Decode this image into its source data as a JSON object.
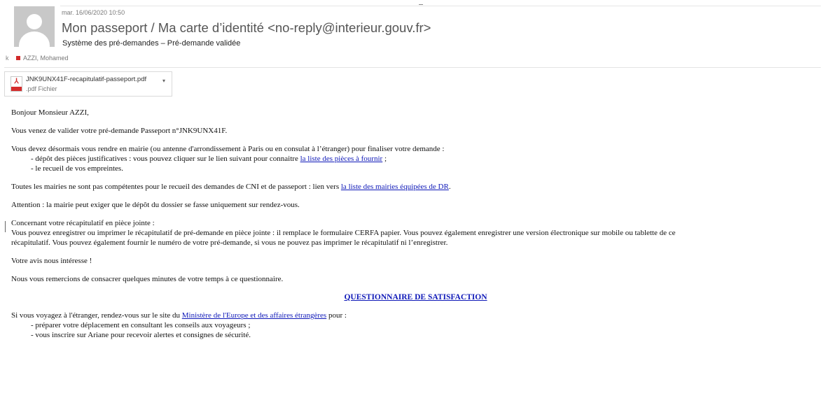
{
  "header": {
    "date": "mar. 16/06/2020 10:50",
    "sender": "Mon passeport / Ma carte d’identité <no-reply@interieur.gouv.fr>",
    "subject": "Système des pré-demandes – Pré-demande validée",
    "recipient_marker": "k",
    "recipient": "AZZI, Mohamed"
  },
  "attachment": {
    "name": "JNK9UNX41F-recapitulatif-passeport.pdf",
    "type": ".pdf Fichier",
    "icon": "pdf-icon",
    "menu_icon": "chevron-down-icon"
  },
  "body": {
    "greeting": "Bonjour Monsieur AZZI,",
    "validation": "Vous venez de valider votre pré-demande Passeport n°JNK9UNX41F.",
    "mairie_intro": "Vous devez désormais vous rendre en mairie (ou antenne d'arrondissement à Paris ou en consulat à l’étranger)  pour finaliser votre demande :",
    "item1_prefix": "- dépôt des pièces justificatives : vous pouvez cliquer sur le lien suivant pour connaitre ",
    "item1_link": "la liste des pièces à fournir",
    "item1_suffix": " ;",
    "item2": "- le recueil de vos empreintes.",
    "mairies_prefix": "Toutes les mairies ne sont pas compétentes pour le recueil des demandes de CNI et de passeport : lien vers ",
    "mairies_link": "la liste des mairies équipées de DR",
    "mairies_suffix": ".",
    "attention": "Attention : la mairie peut exiger que le dépôt du dossier se fasse uniquement sur rendez-vous.",
    "recap_title": "Concernant votre récapitulatif en pièce jointe :",
    "recap_line1": "Vous pouvez enregistrer ou imprimer le récapitulatif de pré-demande en pièce jointe : il remplace le formulaire CERFA papier. Vous pouvez également enregistrer une version électronique sur mobile ou tablette de ce",
    "recap_line2": "récapitulatif.  Vous pouvez également fournir le numéro de votre pré-demande, si vous ne pouvez pas imprimer le récapitulatif ni l’enregistrer.",
    "avis": "Votre avis nous intéresse !",
    "thanks": "Nous vous remercions de consacrer quelques minutes de votre temps à ce questionnaire.",
    "survey_link": "QUESTIONNAIRE DE SATISFACTION",
    "travel_prefix": "Si vous voyagez à l'étranger, rendez-vous sur le site du ",
    "travel_link": "Ministère de l'Europe et des affaires étrangères",
    "travel_suffix": " pour :",
    "travel_item1": "- préparer votre déplacement en consultant les conseils aux voyageurs ;",
    "travel_item2": "- vous inscrire sur Ariane pour recevoir alertes et consignes de sécurité."
  },
  "colors": {
    "link": "#0e18b8",
    "pdf_red": "#d52b2b",
    "avatar_gray": "#c8c8c8"
  }
}
